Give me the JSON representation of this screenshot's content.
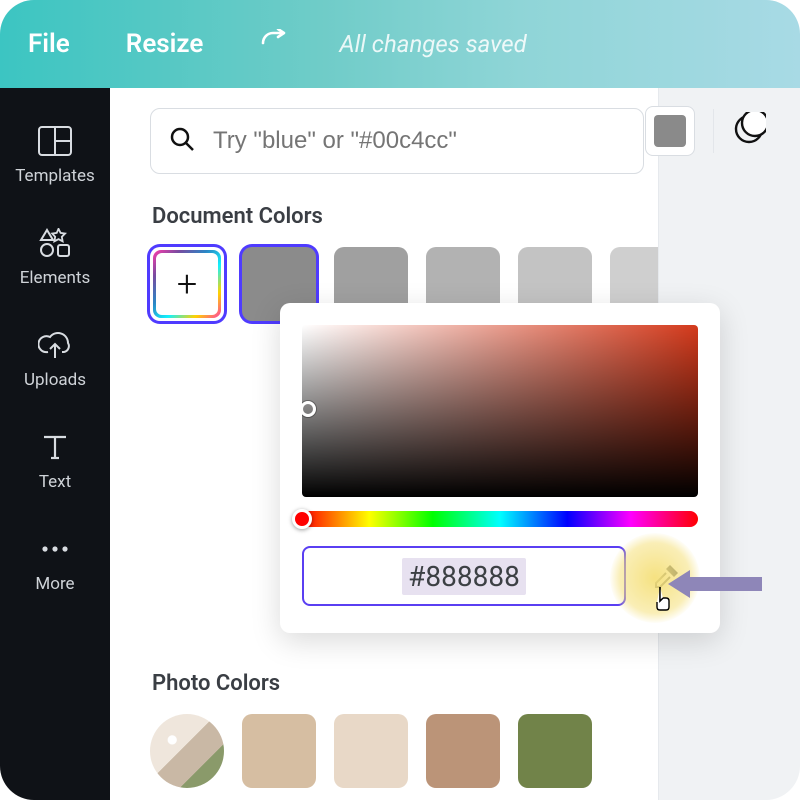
{
  "topbar": {
    "file": "File",
    "resize": "Resize",
    "status": "All changes saved"
  },
  "sidebar": {
    "items": [
      {
        "label": "Templates",
        "icon": "templates-icon"
      },
      {
        "label": "Elements",
        "icon": "elements-icon"
      },
      {
        "label": "Uploads",
        "icon": "uploads-icon"
      },
      {
        "label": "Text",
        "icon": "text-icon"
      },
      {
        "label": "More",
        "icon": "more-icon"
      }
    ]
  },
  "search": {
    "placeholder": "Try \"blue\" or \"#00c4cc\""
  },
  "sections": {
    "document_colors": "Document Colors",
    "photo_colors": "Photo Colors"
  },
  "document_colors": {
    "add": "+",
    "swatches": [
      "#8b8b8b",
      "#a0a0a0",
      "#b2b2b2",
      "#c3c3c3",
      "#cfcfcf"
    ]
  },
  "picker": {
    "hex": "#888888",
    "hue_base": "#d43a1c"
  },
  "photo_colors": {
    "swatches": [
      "#e9dfd4",
      "#d6bea2",
      "#e8d8c7",
      "#bb9478",
      "#718349"
    ]
  },
  "right_tools": {
    "current_color": "#8a8a8a"
  }
}
